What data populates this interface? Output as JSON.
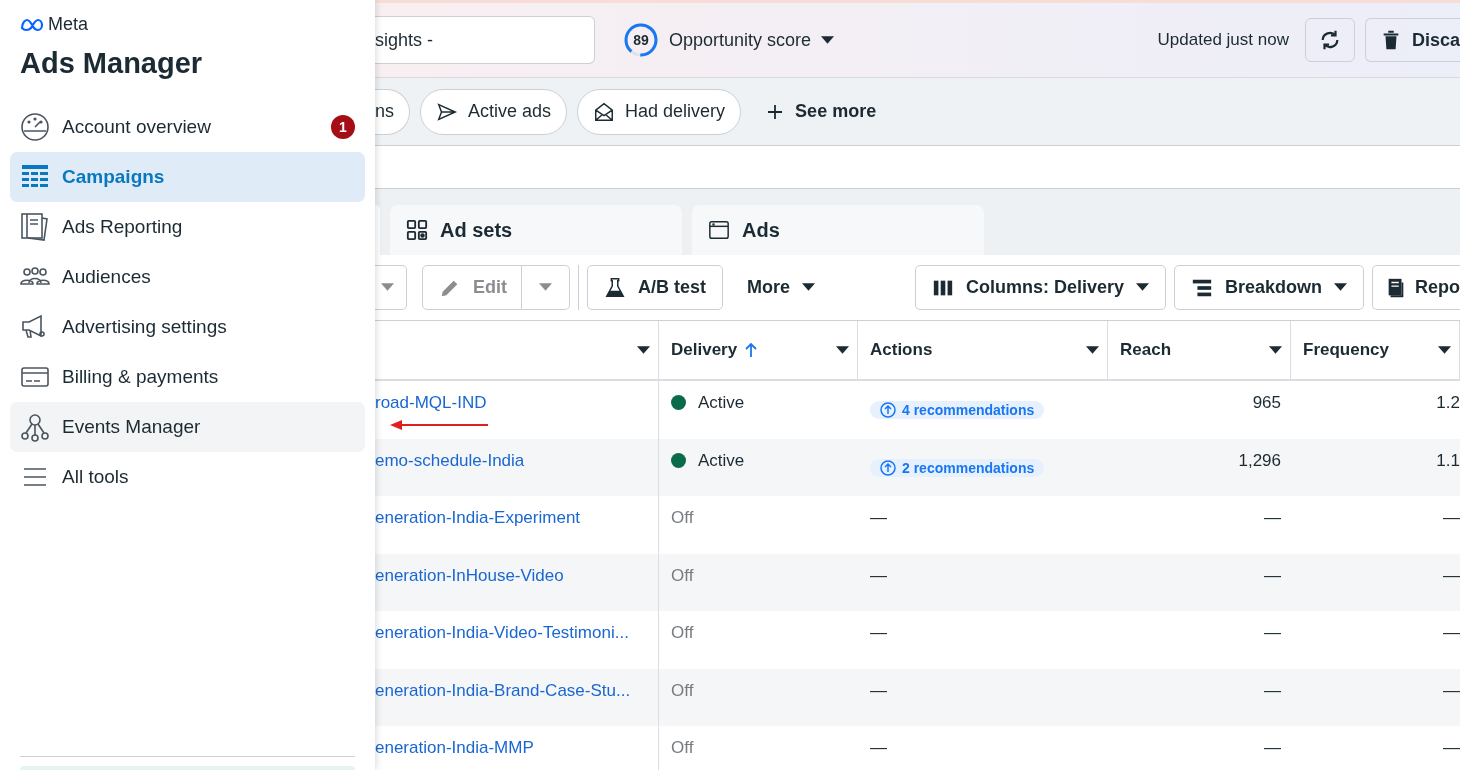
{
  "sidebar": {
    "brand": "Meta",
    "title": "Ads Manager",
    "items": [
      {
        "label": "Account overview",
        "selected": false,
        "hovered": false,
        "badge": "1"
      },
      {
        "label": "Campaigns",
        "selected": true,
        "hovered": false
      },
      {
        "label": "Ads Reporting",
        "selected": false,
        "hovered": false
      },
      {
        "label": "Audiences",
        "selected": false,
        "hovered": false
      },
      {
        "label": "Advertising settings",
        "selected": false,
        "hovered": false
      },
      {
        "label": "Billing & payments",
        "selected": false,
        "hovered": false
      },
      {
        "label": "Events Manager",
        "selected": false,
        "hovered": true
      },
      {
        "label": "All tools",
        "selected": false,
        "hovered": false
      }
    ]
  },
  "top_bar": {
    "search": {
      "value": "sights -"
    },
    "opportunity_score": {
      "value": "89",
      "label": "Opportunity score"
    },
    "updated": "Updated just now",
    "discard_button": "Disca"
  },
  "filters": [
    {
      "label": "ns"
    },
    {
      "label": "Active ads"
    },
    {
      "label": "Had delivery"
    }
  ],
  "see_more": "See more",
  "tabs": [
    {
      "label": "Ad sets",
      "selected": false
    },
    {
      "label": "Ads",
      "selected": false
    }
  ],
  "toolbar": {
    "edit": "Edit",
    "ab_test": "A/B test",
    "more": "More",
    "columns": "Columns: Delivery",
    "breakdown": "Breakdown",
    "reports": "Repo"
  },
  "table": {
    "columns": [
      {
        "label": "Delivery",
        "sorted": true
      },
      {
        "label": "Actions"
      },
      {
        "label": "Reach"
      },
      {
        "label": "Frequency"
      }
    ],
    "rows": [
      {
        "name": "road-MQL-IND",
        "kind": "active",
        "delivery": "Active",
        "actions": "4 recommendations",
        "reach": "965",
        "frequency": "1.2"
      },
      {
        "name": "emo-schedule-India",
        "kind": "active",
        "delivery": "Active",
        "actions": "2 recommendations",
        "reach": "1,296",
        "frequency": "1.1"
      },
      {
        "name": "eneration-India-Experiment",
        "kind": "off",
        "delivery": "Off",
        "actions": "—",
        "reach": "—",
        "frequency": "—"
      },
      {
        "name": "eneration-InHouse-Video",
        "kind": "off",
        "delivery": "Off",
        "actions": "—",
        "reach": "—",
        "frequency": "—"
      },
      {
        "name": "eneration-India-Video-Testimoni...",
        "kind": "off",
        "delivery": "Off",
        "actions": "—",
        "reach": "—",
        "frequency": "—"
      },
      {
        "name": "eneration-India-Brand-Case-Stu...",
        "kind": "off",
        "delivery": "Off",
        "actions": "—",
        "reach": "—",
        "frequency": "—"
      },
      {
        "name": "eneration-India-MMP",
        "kind": "off",
        "delivery": "Off",
        "actions": "—",
        "reach": "—",
        "frequency": "—"
      }
    ]
  }
}
